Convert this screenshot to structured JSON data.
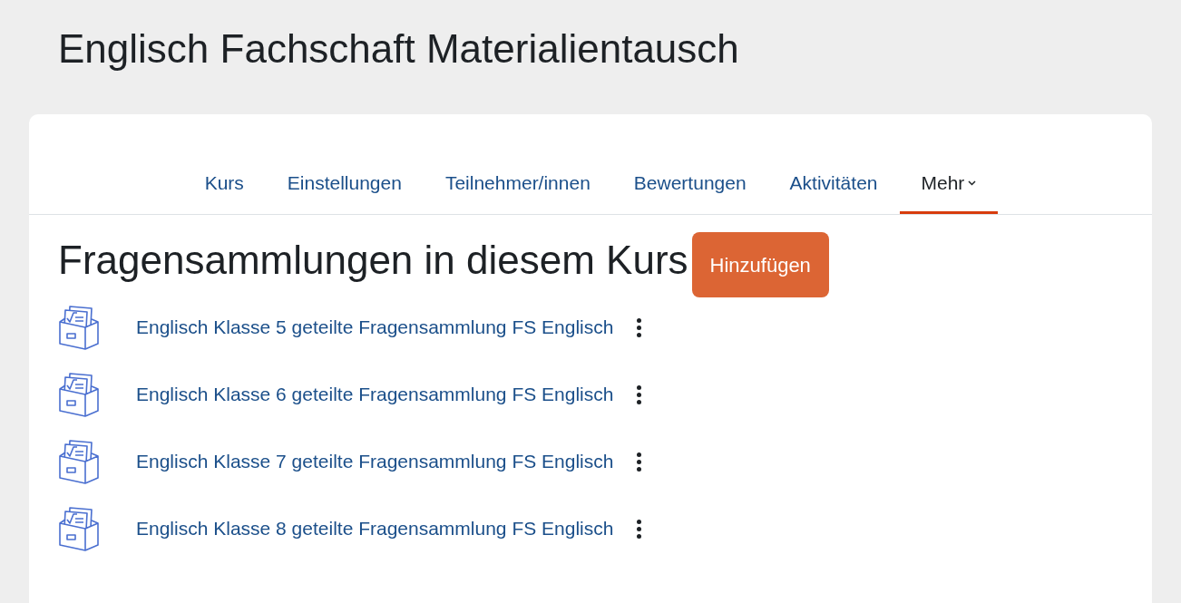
{
  "page_title": "Englisch Fachschaft Materialientausch",
  "tabs": [
    {
      "label": "Kurs",
      "selected": false,
      "dropdown": false
    },
    {
      "label": "Einstellungen",
      "selected": false,
      "dropdown": false
    },
    {
      "label": "Teilnehmer/innen",
      "selected": false,
      "dropdown": false
    },
    {
      "label": "Bewertungen",
      "selected": false,
      "dropdown": false
    },
    {
      "label": "Aktivitäten",
      "selected": false,
      "dropdown": false
    },
    {
      "label": "Mehr",
      "selected": true,
      "dropdown": true
    }
  ],
  "heading": "Fragensammlungen in diesem Kurs",
  "add_button": "Hinzufügen",
  "banks": [
    {
      "name": "Englisch Klasse 5 geteilte Fragensammlung FS Englisch"
    },
    {
      "name": "Englisch Klasse 6 geteilte Fragensammlung FS Englisch"
    },
    {
      "name": "Englisch Klasse 7 geteilte Fragensammlung FS Englisch"
    },
    {
      "name": "Englisch Klasse 8 geteilte Fragensammlung FS Englisch"
    }
  ]
}
